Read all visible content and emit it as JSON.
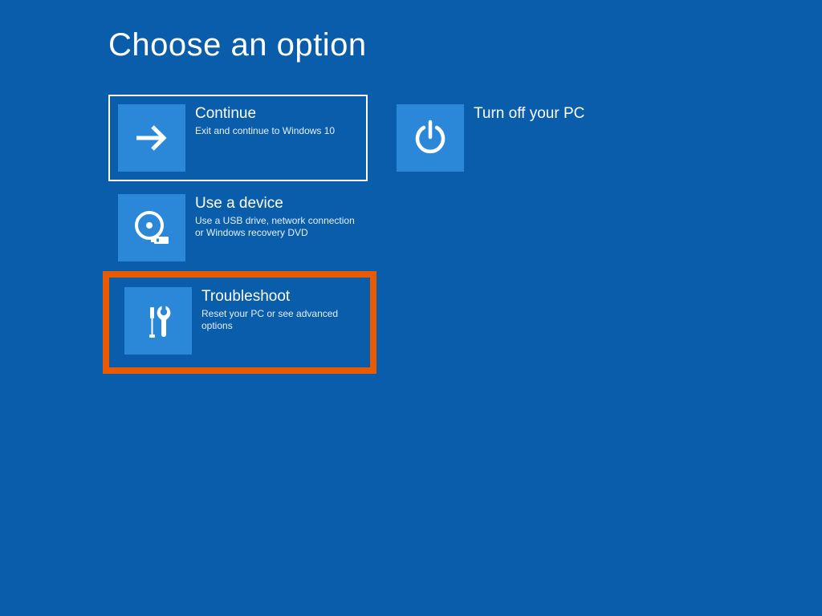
{
  "heading": "Choose an option",
  "tiles": {
    "continue": {
      "title": "Continue",
      "desc": "Exit and continue to Windows 10"
    },
    "turn_off": {
      "title": "Turn off your PC",
      "desc": ""
    },
    "use_device": {
      "title": "Use a device",
      "desc": "Use a USB drive, network connection or Windows recovery DVD"
    },
    "troubleshoot": {
      "title": "Troubleshoot",
      "desc": "Reset your PC or see advanced options"
    }
  },
  "colors": {
    "background": "#0a5dab",
    "tile_icon_bg": "#2b88d8",
    "highlight_border": "#ea5a00",
    "selected_border": "#ffffff"
  }
}
